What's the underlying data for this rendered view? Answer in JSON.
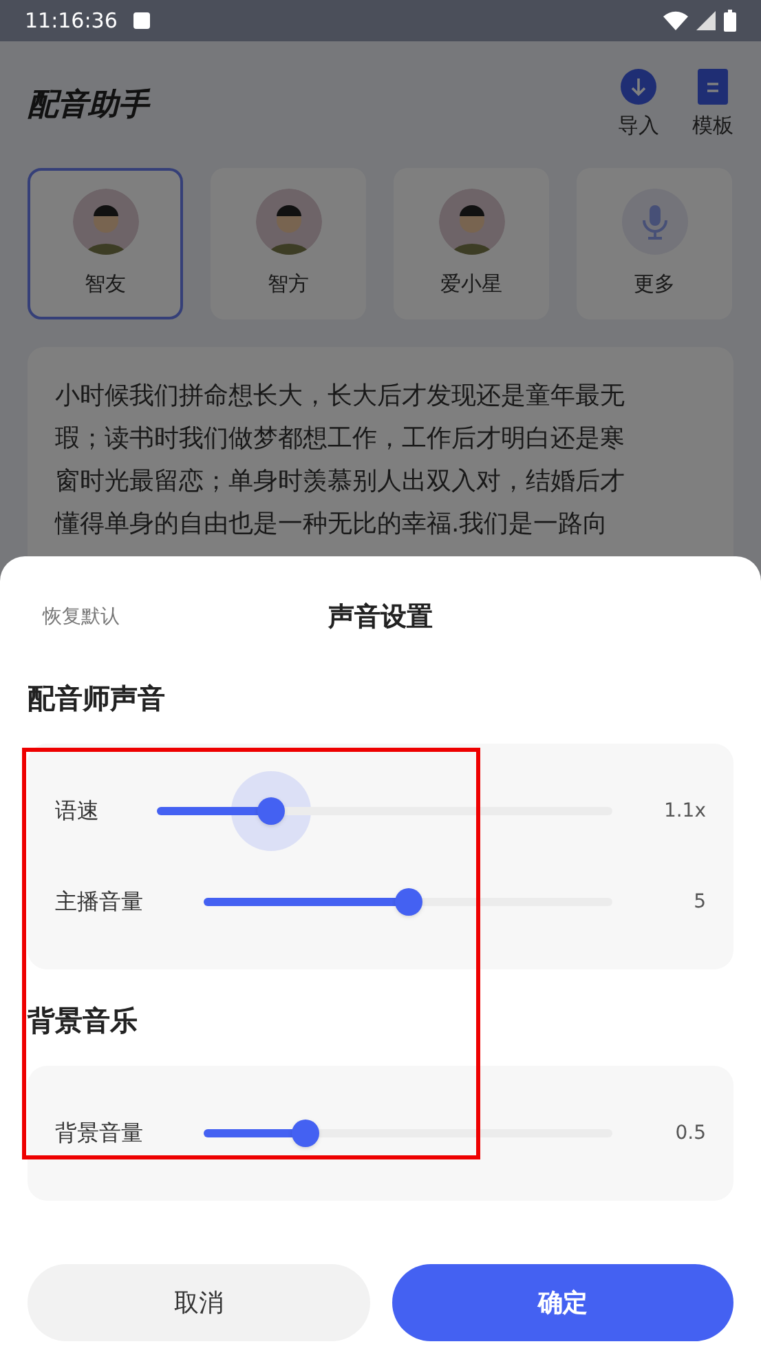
{
  "status_bar": {
    "time": "11:16:36"
  },
  "header": {
    "title": "配音助手",
    "actions": [
      {
        "label": "导入",
        "kind": "import"
      },
      {
        "label": "模板",
        "kind": "template"
      }
    ]
  },
  "voices": [
    {
      "name": "智友",
      "selected": true,
      "kind": "person"
    },
    {
      "name": "智方",
      "selected": false,
      "kind": "person"
    },
    {
      "name": "爱小星",
      "selected": false,
      "kind": "person"
    },
    {
      "name": "更多",
      "selected": false,
      "kind": "more"
    }
  ],
  "script_text": [
    "小时候我们拼命想长大，长大后才发现还是童年最无",
    "瑕；读书时我们做梦都想工作，工作后才明白还是寒",
    "窗时光最留恋；单身时羡慕别人出双入对，结婚后才",
    "懂得单身的自由也是一种无比的幸福.我们是一路向"
  ],
  "sheet": {
    "reset": "恢复默认",
    "title": "声音设置",
    "sections": [
      {
        "title": "配音师声音",
        "sliders": [
          {
            "label": "语速",
            "level": 0.25,
            "reading": "1.1x",
            "pressed": true
          },
          {
            "label": "主播音量",
            "level": 0.5,
            "reading": "5",
            "pressed": false
          }
        ]
      },
      {
        "title": "背景音乐",
        "sliders": [
          {
            "label": "背景音量",
            "level": 0.25,
            "reading": "0.5",
            "pressed": false
          }
        ]
      }
    ],
    "buttons": [
      {
        "label": "取消",
        "kind": "secondary"
      },
      {
        "label": "确定",
        "kind": "primary"
      }
    ]
  }
}
